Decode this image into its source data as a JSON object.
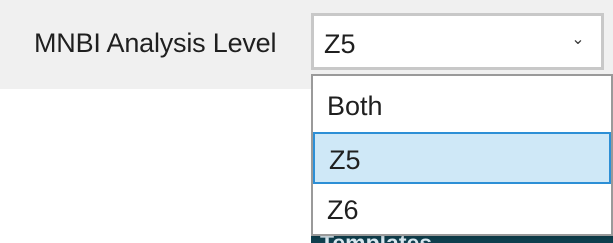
{
  "field": {
    "label": "MNBI Analysis Level",
    "selected_value": "Z5",
    "chevron_icon": "chevron-down-icon"
  },
  "dropdown": {
    "options": [
      {
        "label": "Both",
        "selected": false
      },
      {
        "label": "Z5",
        "selected": true
      },
      {
        "label": "Z6",
        "selected": false
      }
    ]
  },
  "background_window": {
    "partial_text": "Templates"
  },
  "colors": {
    "selection_bg": "#cfe8f7",
    "selection_border": "#2d8fd6",
    "window_dark": "#0f3f4e"
  }
}
